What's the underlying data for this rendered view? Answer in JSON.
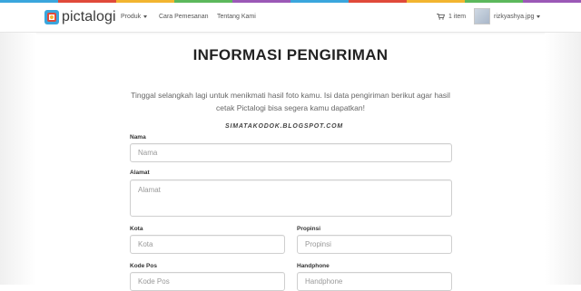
{
  "colors": {
    "stripe": [
      "#3aa6dd",
      "#e04a3b",
      "#f2b530",
      "#5cb85c",
      "#9b59b6",
      "#3aa6dd",
      "#e04a3b",
      "#f2b530",
      "#5cb85c",
      "#9b59b6"
    ]
  },
  "navbar": {
    "brand": "pictalogi",
    "menu": {
      "produk": "Produk",
      "cara_pemesanan": "Cara Pemesanan",
      "tentang_kami": "Tentang Kami"
    },
    "cart_label": "1 item",
    "user_name": "rizkyashya.jpg"
  },
  "page": {
    "title": "INFORMASI PENGIRIMAN",
    "intro": "Tinggal selangkah lagi untuk menikmati hasil foto kamu. Isi data pengiriman berikut agar hasil cetak Pictalogi bisa segera kamu dapatkan!",
    "watermark": "SIMATAKODOK.BLOGSPOT.COM"
  },
  "form": {
    "nama": {
      "label": "Nama",
      "placeholder": "Nama",
      "value": ""
    },
    "alamat": {
      "label": "Alamat",
      "placeholder": "Alamat",
      "value": ""
    },
    "kota": {
      "label": "Kota",
      "placeholder": "Kota",
      "value": ""
    },
    "propinsi": {
      "label": "Propinsi",
      "placeholder": "Propinsi",
      "value": ""
    },
    "kode_pos": {
      "label": "Kode Pos",
      "placeholder": "Kode Pos",
      "value": ""
    },
    "handphone": {
      "label": "Handphone",
      "placeholder": "Handphone",
      "value": ""
    }
  }
}
